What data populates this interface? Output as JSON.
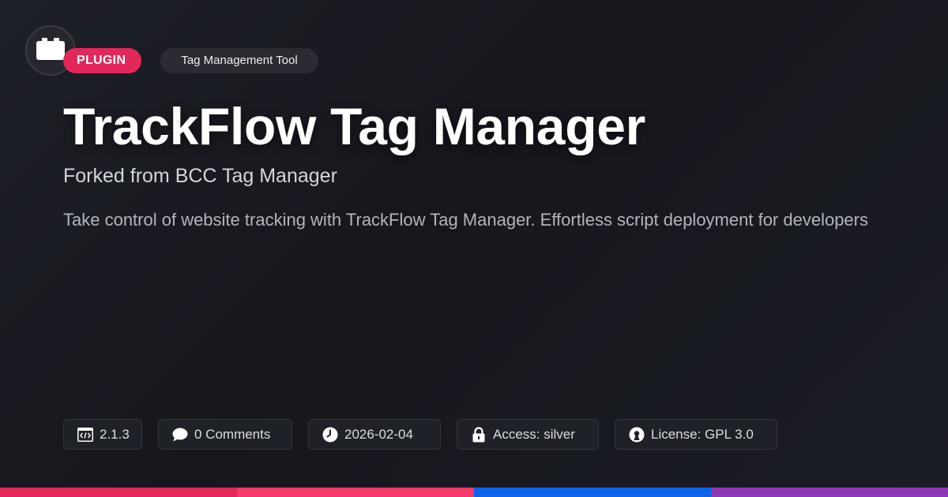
{
  "header": {
    "type_badge": "PLUGIN",
    "category": "Tag Management Tool"
  },
  "title": "TrackFlow Tag Manager",
  "subtitle": "Forked from BCC Tag Manager",
  "description": "Take control of website tracking with TrackFlow Tag Manager. Effortless script deployment for developers",
  "meta": {
    "version": "2.1.3",
    "comments": "0 Comments",
    "date": "2026-02-04",
    "access": "Access: silver",
    "license": "License: GPL 3.0"
  },
  "icons": {
    "logo": "plugin-block-icon",
    "version": "code-icon",
    "comments": "speech-bubble-icon",
    "date": "clock-icon",
    "access": "lock-icon",
    "license": "open-source-icon"
  },
  "colors": {
    "badge": "#e2285a",
    "bar": [
      "#e2285a",
      "#f5386a",
      "#0e63e8",
      "#8c3ab5"
    ]
  }
}
